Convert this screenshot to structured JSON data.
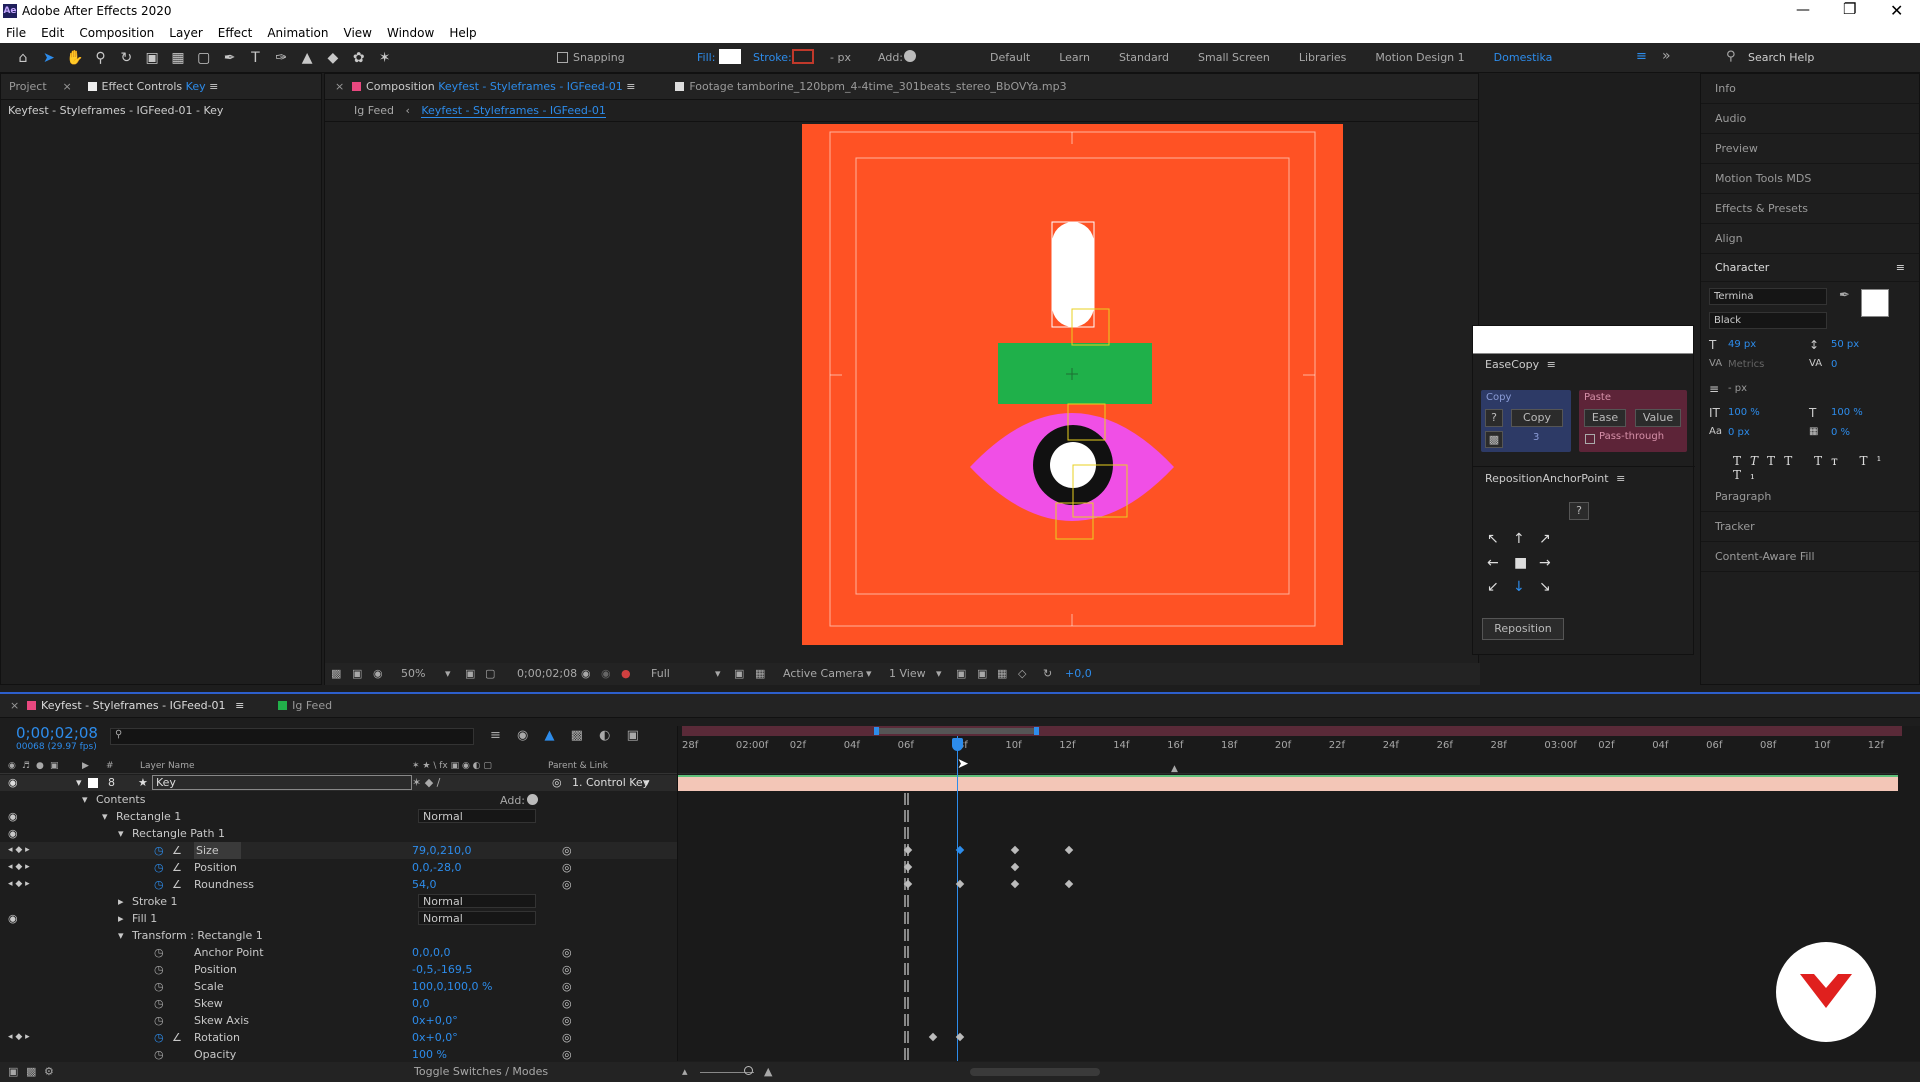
{
  "app": {
    "title": "Adobe After Effects 2020",
    "icon_text": "Ae"
  },
  "menu": [
    "File",
    "Edit",
    "Composition",
    "Layer",
    "Effect",
    "Animation",
    "View",
    "Window",
    "Help"
  ],
  "toolbar": {
    "snapping": "Snapping",
    "fill": "Fill:",
    "stroke": "Stroke:",
    "stroke_px": "- px",
    "add": "Add:",
    "workspaces": [
      "Default",
      "Learn",
      "Standard",
      "Small Screen",
      "Libraries",
      "Motion Design 1",
      "Domestika"
    ],
    "active_workspace": "Domestika",
    "search_placeholder": "Search Help"
  },
  "left_panel": {
    "tab_project": "Project",
    "tab_effect": "Effect Controls",
    "tab_effect_layer": "Key",
    "breadcrumb": "Keyfest - Styleframes - IGFeed-01 - Key"
  },
  "comp_panel": {
    "tab_prefix": "Composition",
    "tab_name": "Keyfest - Styleframes - IGFeed-01",
    "footage_tab": "Footage tamborine_120bpm_4-4time_301beats_stereo_BbOVYa.mp3",
    "crumb_parent": "Ig Feed",
    "crumb_current": "Keyfest - Styleframes - IGFeed-01",
    "zoom": "50%",
    "timecode": "0;00;02;08",
    "resolution": "Full",
    "camera": "Active Camera",
    "views": "1 View",
    "exposure": "+0,0"
  },
  "colors": {
    "canvas": "#ff5224",
    "green": "#1fb04a",
    "magenta": "#f04fe6",
    "accent": "#2d8ceb"
  },
  "easecopy": {
    "title": "EaseCopy",
    "copy_label": "Copy",
    "paste_label": "Paste",
    "q": "?",
    "copy_btn": "Copy",
    "count": "3",
    "ease_btn": "Ease",
    "value_btn": "Value",
    "passthrough": "Pass-through"
  },
  "reposition": {
    "title": "RepositionAnchorPoint",
    "q": "?",
    "button": "Reposition"
  },
  "right_panel": {
    "items": [
      "Info",
      "Audio",
      "Preview",
      "Motion Tools MDS",
      "Effects & Presets",
      "Align"
    ],
    "character": "Character",
    "font": "Termina",
    "style": "Black",
    "size": "49 px",
    "leading": "50 px",
    "kerning": "Metrics",
    "tracking": "0",
    "stroke_width": "- px",
    "vscale": "100 %",
    "hscale": "100 %",
    "baseline": "0 px",
    "tsume": "0 %",
    "bottom_items": [
      "Paragraph",
      "Tracker",
      "Content-Aware Fill"
    ]
  },
  "timeline": {
    "tab": "Keyfest - Styleframes - IGFeed-01",
    "tab2": "Ig Feed",
    "timecode": "0;00;02;08",
    "frame_info": "00068 (29.97 fps)",
    "ruler": [
      "28f",
      "02:00f",
      "02f",
      "04f",
      "06f",
      "08f",
      "10f",
      "12f",
      "14f",
      "16f",
      "18f",
      "20f",
      "22f",
      "24f",
      "26f",
      "28f",
      "03:00f",
      "02f",
      "04f",
      "06f",
      "08f",
      "10f",
      "12f"
    ],
    "col_layer_name": "Layer Name",
    "col_parent": "Parent & Link",
    "layer_num": "8",
    "layer_name": "Key",
    "parent": "1. Control Key",
    "add": "Add:",
    "rows": [
      {
        "label": "Contents",
        "indent": 0,
        "value": "",
        "mode": ""
      },
      {
        "label": "Rectangle 1",
        "indent": 1,
        "value": "",
        "mode": "Normal"
      },
      {
        "label": "Rectangle Path 1",
        "indent": 2,
        "value": "",
        "mode": ""
      },
      {
        "label": "Size",
        "indent": 3,
        "value": "79,0,210,0",
        "mode": ""
      },
      {
        "label": "Position",
        "indent": 3,
        "value": "0,0,-28,0",
        "mode": ""
      },
      {
        "label": "Roundness",
        "indent": 3,
        "value": "54,0",
        "mode": ""
      },
      {
        "label": "Stroke 1",
        "indent": 2,
        "value": "",
        "mode": "Normal"
      },
      {
        "label": "Fill 1",
        "indent": 2,
        "value": "",
        "mode": "Normal"
      },
      {
        "label": "Transform : Rectangle 1",
        "indent": 2,
        "value": "",
        "mode": ""
      },
      {
        "label": "Anchor Point",
        "indent": 3,
        "value": "0,0,0,0",
        "mode": ""
      },
      {
        "label": "Position",
        "indent": 3,
        "value": "-0,5,-169,5",
        "mode": ""
      },
      {
        "label": "Scale",
        "indent": 3,
        "value": "100,0,100,0 %",
        "mode": ""
      },
      {
        "label": "Skew",
        "indent": 3,
        "value": "0,0",
        "mode": ""
      },
      {
        "label": "Skew Axis",
        "indent": 3,
        "value": "0x+0,0°",
        "mode": ""
      },
      {
        "label": "Rotation",
        "indent": 3,
        "value": "0x+0,0°",
        "mode": ""
      },
      {
        "label": "Opacity",
        "indent": 3,
        "value": "100 %",
        "mode": ""
      }
    ],
    "toggle": "Toggle Switches / Modes"
  }
}
